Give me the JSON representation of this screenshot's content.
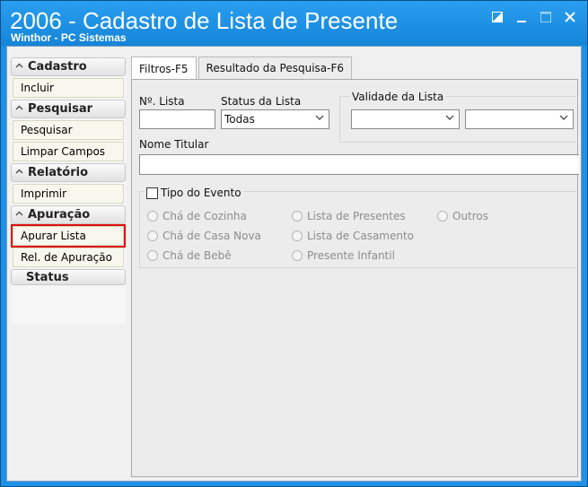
{
  "window": {
    "title": "2006 - Cadastro de Lista de Presente",
    "subtitle": "Winthor - PC Sistemas",
    "controls": [
      "restore-icon",
      "minimize-icon",
      "maximize-icon",
      "close-icon"
    ]
  },
  "nav": {
    "cadastro": {
      "header": "Cadastro",
      "items": [
        "Incluir"
      ]
    },
    "pesquisar": {
      "header": "Pesquisar",
      "items": [
        "Pesquisar",
        "Limpar Campos"
      ]
    },
    "relatorio": {
      "header": "Relatório",
      "items": [
        "Imprimir"
      ]
    },
    "apuracao": {
      "header": "Apuração",
      "items": [
        "Apurar Lista",
        "Rel. de Apuração"
      ]
    },
    "status": {
      "header": "Status"
    }
  },
  "tabs": [
    "Filtros-F5",
    "Resultado da Pesquisa-F6"
  ],
  "filters": {
    "numero_lista_label": "Nº. Lista",
    "numero_lista_value": "",
    "status_label": "Status da Lista",
    "status_value": "Todas",
    "validade_label": "Validade da Lista",
    "validade_inicio": "",
    "validade_fim": "",
    "nome_titular_label": "Nome Titular",
    "nome_titular_value": "",
    "tipo_evento_label": "Tipo do Evento",
    "tipo_evento_checked": false,
    "eventos": [
      "Chá de Cozinha",
      "Lista de Presentes",
      "Outros",
      "Chá de Casa Nova",
      "Lista de Casamento",
      "Chá de Bebê",
      "Presente Infantil"
    ]
  }
}
